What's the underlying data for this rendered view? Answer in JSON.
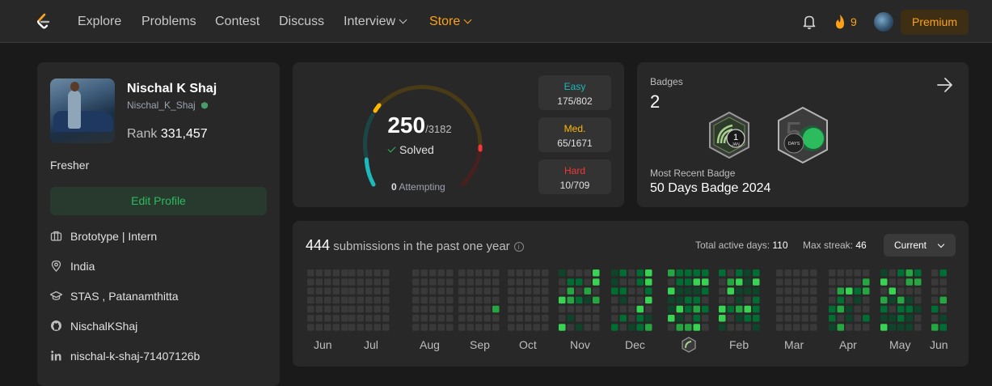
{
  "nav": {
    "items": [
      {
        "label": "Explore"
      },
      {
        "label": "Problems"
      },
      {
        "label": "Contest"
      },
      {
        "label": "Discuss"
      },
      {
        "label": "Interview"
      },
      {
        "label": "Store"
      }
    ],
    "streak_count": "9",
    "premium_label": "Premium",
    "colors": {
      "accent": "#ffa116"
    }
  },
  "profile": {
    "name": "Nischal K Shaj",
    "username": "Nischal_K_Shaj",
    "rank_label": "Rank",
    "rank_value": "331,457",
    "summary": "Fresher",
    "edit_label": "Edit Profile",
    "details": [
      {
        "icon": "briefcase-icon",
        "text": "Brototype | Intern"
      },
      {
        "icon": "location-icon",
        "text": "India"
      },
      {
        "icon": "graduation-cap-icon",
        "text": "STAS , Patanamthitta"
      },
      {
        "icon": "github-icon",
        "text": "NischalKShaj"
      },
      {
        "icon": "linkedin-icon",
        "text": "nischal-k-shaj-71407126b"
      }
    ]
  },
  "solved": {
    "count": "250",
    "total": "/3182",
    "label": "Solved",
    "attempting_count": "0",
    "attempting_label": " Attempting",
    "difficulties": [
      {
        "label": "Easy",
        "value": "175/802",
        "color": "#1cbaba"
      },
      {
        "label": "Med.",
        "value": "65/1671",
        "color": "#ffb700"
      },
      {
        "label": "Hard",
        "value": "10/709",
        "color": "#f63737"
      }
    ]
  },
  "badges": {
    "label": "Badges",
    "count": "2",
    "recent_label": "Most Recent Badge",
    "recent_value": "50 Days Badge 2024",
    "items": [
      {
        "name": "jan-badge",
        "text_top": "1",
        "text_bottom": "JAN"
      },
      {
        "name": "50-days-badge",
        "text_top": "5",
        "text_bottom": "DAYS"
      }
    ]
  },
  "submissions": {
    "count": "444",
    "text": " submissions in the past one year",
    "active_days_label": "Total active days: ",
    "active_days": "110",
    "max_streak_label": "Max streak: ",
    "max_streak": "46",
    "range_label": "Current",
    "months": [
      "Jun",
      "Jul",
      "Aug",
      "Sep",
      "Oct",
      "Nov",
      "Dec",
      "Jan",
      "Feb",
      "Mar",
      "Apr",
      "May",
      "Jun"
    ]
  }
}
